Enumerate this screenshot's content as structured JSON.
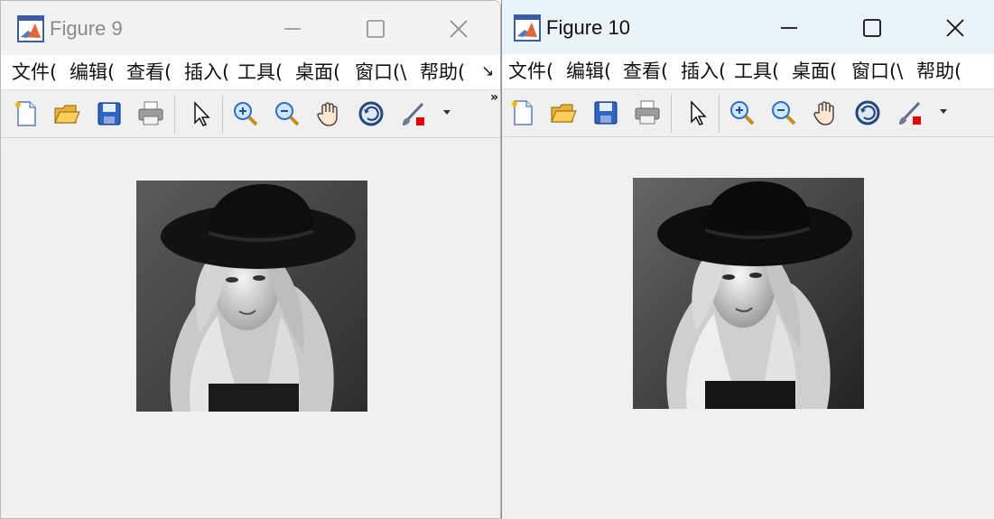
{
  "windows": [
    {
      "title": "Figure 9",
      "menu": [
        "文件(",
        "编辑(",
        "查看(",
        "插入(",
        "工具(",
        "桌面(",
        "窗口(\\",
        "帮助("
      ],
      "menu_overflow": "↘"
    },
    {
      "title": "Figure 10",
      "menu": [
        "文件(",
        "编辑(",
        "查看(",
        "插入(",
        "工具(",
        "桌面(",
        "窗口(\\",
        "帮助("
      ]
    }
  ],
  "toolbar": {
    "overflow": "»",
    "icons": [
      "new-figure-icon",
      "open-icon",
      "save-icon",
      "print-icon",
      "select-pointer-icon",
      "zoom-in-icon",
      "zoom-out-icon",
      "pan-hand-icon",
      "rotate-3d-icon",
      "brush-icon"
    ]
  },
  "colors": {
    "accent_red": "#e00000",
    "matlab_orange": "#e16737",
    "icon_blue": "#2f63c6"
  },
  "image_content": "grayscale portrait"
}
